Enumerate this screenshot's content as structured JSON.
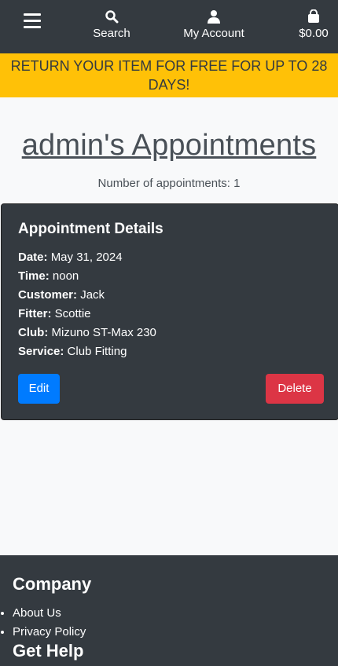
{
  "nav": {
    "search_label": "Search",
    "account_label": "My Account",
    "bag_total": "$0.00"
  },
  "banner": {
    "text": "RETURN YOUR ITEM FOR FREE FOR UP TO 28 DAYS!"
  },
  "page": {
    "title": "admin's Appointments",
    "count_text": "Number of appointments: 1"
  },
  "appointment": {
    "heading": "Appointment Details",
    "fields": [
      {
        "label": "Date:",
        "value": "May 31, 2024"
      },
      {
        "label": "Time:",
        "value": "noon"
      },
      {
        "label": "Customer:",
        "value": "Jack"
      },
      {
        "label": "Fitter:",
        "value": "Scottie"
      },
      {
        "label": "Club:",
        "value": "Mizuno ST-Max 230"
      },
      {
        "label": "Service:",
        "value": "Club Fitting"
      }
    ],
    "edit_label": "Edit",
    "delete_label": "Delete"
  },
  "footer": {
    "company_heading": "Company",
    "links": [
      "About Us",
      "Privacy Policy"
    ],
    "help_heading": "Get Help"
  },
  "colors": {
    "dark": "#343a40",
    "banner": "#ffc107",
    "edit": "#007bff",
    "delete": "#dc3545"
  }
}
